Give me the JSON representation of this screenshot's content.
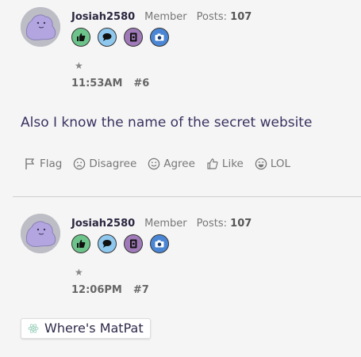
{
  "posts": [
    {
      "username": "Josiah2580",
      "role": "Member",
      "posts_label": "Posts:",
      "posts_count": "107",
      "badge_icons": [
        "thumbs-up-icon",
        "chat-bubble-icon",
        "notebook-icon",
        "camera-icon"
      ],
      "star": "★",
      "time": "11:53AM",
      "number": "#6",
      "message": "Also I know the name of the secret website",
      "reactions": [
        {
          "icon": "flag-icon",
          "label": "Flag"
        },
        {
          "icon": "frown-face-icon",
          "label": "Disagree"
        },
        {
          "icon": "smile-face-icon",
          "label": "Agree"
        },
        {
          "icon": "thumbs-up-outline-icon",
          "label": "Like"
        },
        {
          "icon": "laugh-face-icon",
          "label": "LOL"
        }
      ]
    },
    {
      "username": "Josiah2580",
      "role": "Member",
      "posts_label": "Posts:",
      "posts_count": "107",
      "badge_icons": [
        "thumbs-up-icon",
        "chat-bubble-icon",
        "notebook-icon",
        "camera-icon"
      ],
      "star": "★",
      "time": "12:06PM",
      "number": "#7",
      "link_chip": "Where's MatPat"
    }
  ],
  "colors": {
    "badge_green": "#6cc48a",
    "badge_blue": "#8fc8ef",
    "badge_purple": "#a07ab8",
    "badge_royal": "#4a86d4",
    "avatar_ditto": "#b3a6e0",
    "accent_text": "#3a3160"
  }
}
